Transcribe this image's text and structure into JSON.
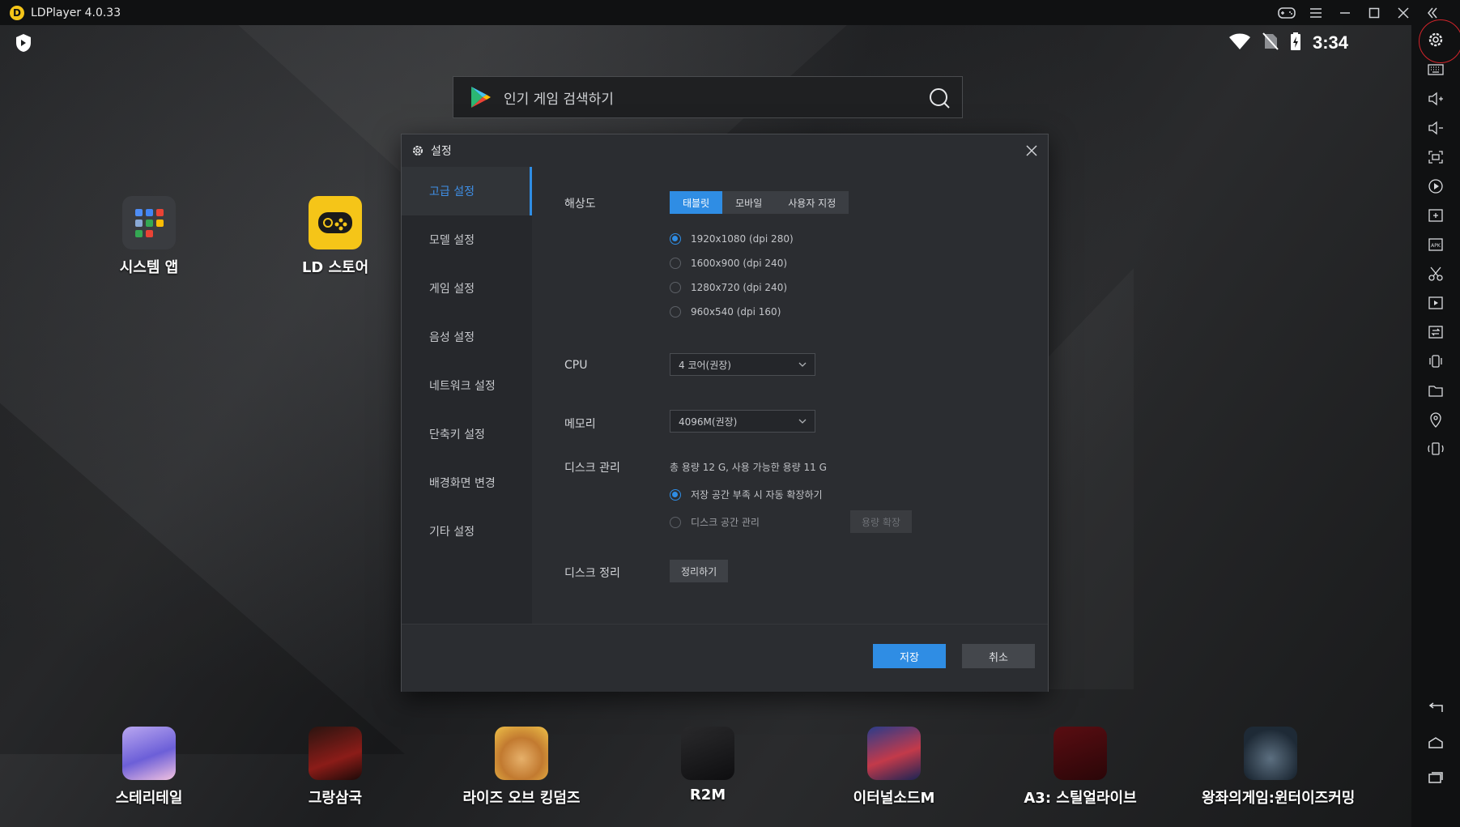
{
  "window": {
    "title": "LDPlayer 4.0.33"
  },
  "status": {
    "time": "3:34"
  },
  "search": {
    "placeholder": "인기 게임 검색하기"
  },
  "home_apps": [
    {
      "label": "시스템 앱"
    },
    {
      "label": "LD 스토어"
    }
  ],
  "dock_apps": [
    {
      "label": "스테리테일"
    },
    {
      "label": "그랑삼국"
    },
    {
      "label": "라이즈 오브 킹덤즈"
    },
    {
      "label": "R2M"
    },
    {
      "label": "이터널소드M"
    },
    {
      "label": "A3: 스틸얼라이브"
    },
    {
      "label": "왕좌의게임:윈터이즈커밍"
    }
  ],
  "dialog": {
    "title": "설정",
    "nav": [
      {
        "label": "고급 설정",
        "active": true
      },
      {
        "label": "모델 설정"
      },
      {
        "label": "게임 설정"
      },
      {
        "label": "음성 설정"
      },
      {
        "label": "네트워크 설정"
      },
      {
        "label": "단축키 설정"
      },
      {
        "label": "배경화면 변경"
      },
      {
        "label": "기타 설정"
      }
    ],
    "resolution": {
      "label": "해상도",
      "tabs": [
        "태블릿",
        "모바일",
        "사용자 지정"
      ],
      "active_tab": "태블릿",
      "options": [
        {
          "label": "1920x1080  (dpi 280)",
          "selected": true
        },
        {
          "label": "1600x900  (dpi 240)"
        },
        {
          "label": "1280x720  (dpi 240)"
        },
        {
          "label": "960x540  (dpi 160)"
        }
      ]
    },
    "cpu": {
      "label": "CPU",
      "value": "4 코어(권장)"
    },
    "memory": {
      "label": "메모리",
      "value": "4096M(권장)"
    },
    "disk": {
      "label": "디스크 관리",
      "info": "총 용량 12 G,  사용 가능한 용량 11 G",
      "option_auto": "저장 공간 부족 시 자동 확장하기",
      "option_manual": "디스크 공간 관리",
      "expand_button": "용량 확장"
    },
    "cleanup": {
      "label": "디스크 정리",
      "button": "정리하기"
    },
    "save": "저장",
    "cancel": "취소"
  },
  "colors": {
    "accent": "#2f8de4",
    "highlight_ring": "#d2242a",
    "store_yellow": "#f5c518"
  }
}
